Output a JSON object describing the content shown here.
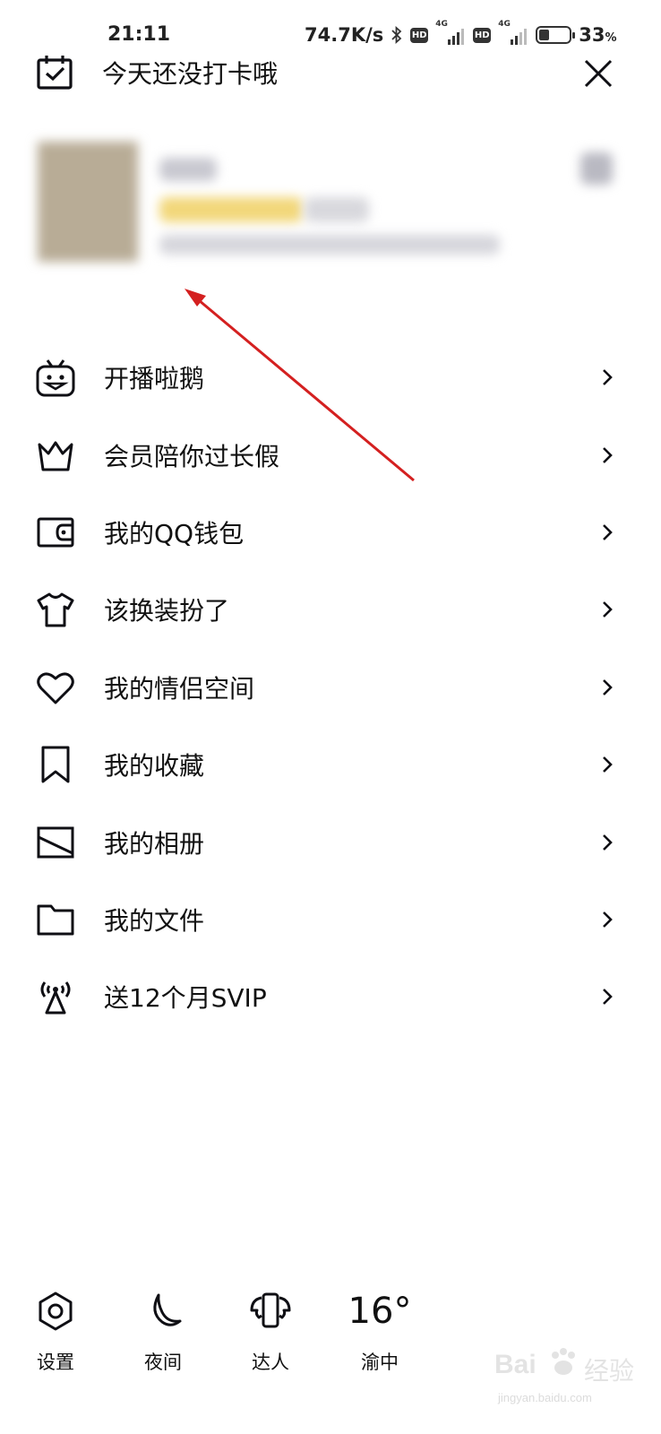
{
  "status_bar": {
    "time": "21:11",
    "net_speed": "74.7K/s",
    "battery_value": "33",
    "battery_unit": "%",
    "network_badges": [
      "HD",
      "4G",
      "HD",
      "4G"
    ]
  },
  "header": {
    "checkin_text": "今天还没打卡哦"
  },
  "menu": {
    "items": [
      {
        "label": "开播啦鹅",
        "icon": "tv-mascot-icon"
      },
      {
        "label": "会员陪你过长假",
        "icon": "crown-icon"
      },
      {
        "label": "我的QQ钱包",
        "icon": "wallet-icon"
      },
      {
        "label": "该换装扮了",
        "icon": "tshirt-icon"
      },
      {
        "label": "我的情侣空间",
        "icon": "heart-icon"
      },
      {
        "label": "我的收藏",
        "icon": "bookmark-icon"
      },
      {
        "label": "我的相册",
        "icon": "photo-icon"
      },
      {
        "label": "我的文件",
        "icon": "folder-icon"
      },
      {
        "label": "送12个月SVIP",
        "icon": "broadcast-icon"
      }
    ]
  },
  "bottom_bar": {
    "settings_label": "设置",
    "night_label": "夜间",
    "expert_label": "达人",
    "temperature": "16°",
    "location": "渝中"
  },
  "watermark": {
    "brand": "Bai",
    "brand_cn": "经验",
    "url": "jingyan.baidu.com"
  },
  "colors": {
    "text": "#111111",
    "annotation_arrow": "#d42020",
    "background": "#ffffff"
  }
}
